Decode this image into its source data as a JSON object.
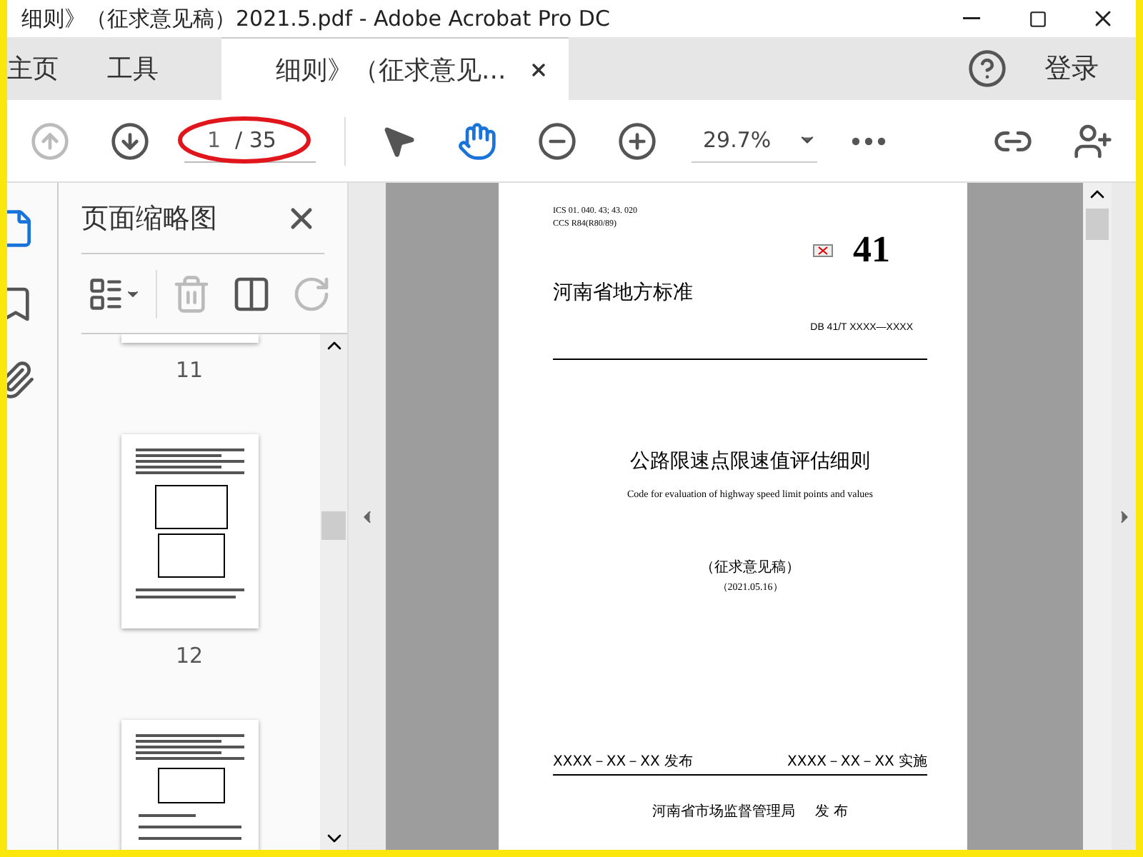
{
  "window": {
    "title": "细则》（征求意见稿）2021.5.pdf - Adobe Acrobat Pro DC"
  },
  "tabs": [
    {
      "label": "主页",
      "kind": "home",
      "selected": false
    },
    {
      "label": "工具",
      "kind": "tools",
      "selected": false
    },
    {
      "label": "细则》（征求意见...",
      "kind": "document",
      "selected": true
    }
  ],
  "account": {
    "login": "登录"
  },
  "toolbar": {
    "prev_disabled": true,
    "next_disabled": false,
    "page_number": "1",
    "page_total": "/ 35",
    "zoom": "29.7%",
    "tools": [
      {
        "kind": "select",
        "selected": false
      },
      {
        "kind": "hand",
        "selected": true
      }
    ]
  },
  "sidebar": {
    "rail": [
      {
        "kind": "pages",
        "selected": true
      },
      {
        "kind": "bookmarks",
        "selected": false
      },
      {
        "kind": "attachments",
        "selected": false
      }
    ],
    "panel_title": "页面缩略图",
    "thumbnails": [
      {
        "kind": "tail",
        "label": "11"
      },
      {
        "kind": "tables",
        "label": "12"
      },
      {
        "kind": "formulas"
      }
    ]
  },
  "document": {
    "ics": "ICS  01. 040. 43; 43. 020",
    "ccs": "CCS  R84(R80/89)",
    "number": "41",
    "org": "河南省地方标准",
    "code": "DB 41/T  XXXX—XXXX",
    "title": "公路限速点限速值评估细则",
    "subtitle": "Code for evaluation of highway speed limit points and values",
    "draft": "（征求意见稿）",
    "date": "（2021.05.16）",
    "published": "XXXX－XX－XX 发布",
    "implemented": "XXXX－XX－XX 实施",
    "issuer": "河南省市场监督管理局",
    "issue": "发  布"
  }
}
